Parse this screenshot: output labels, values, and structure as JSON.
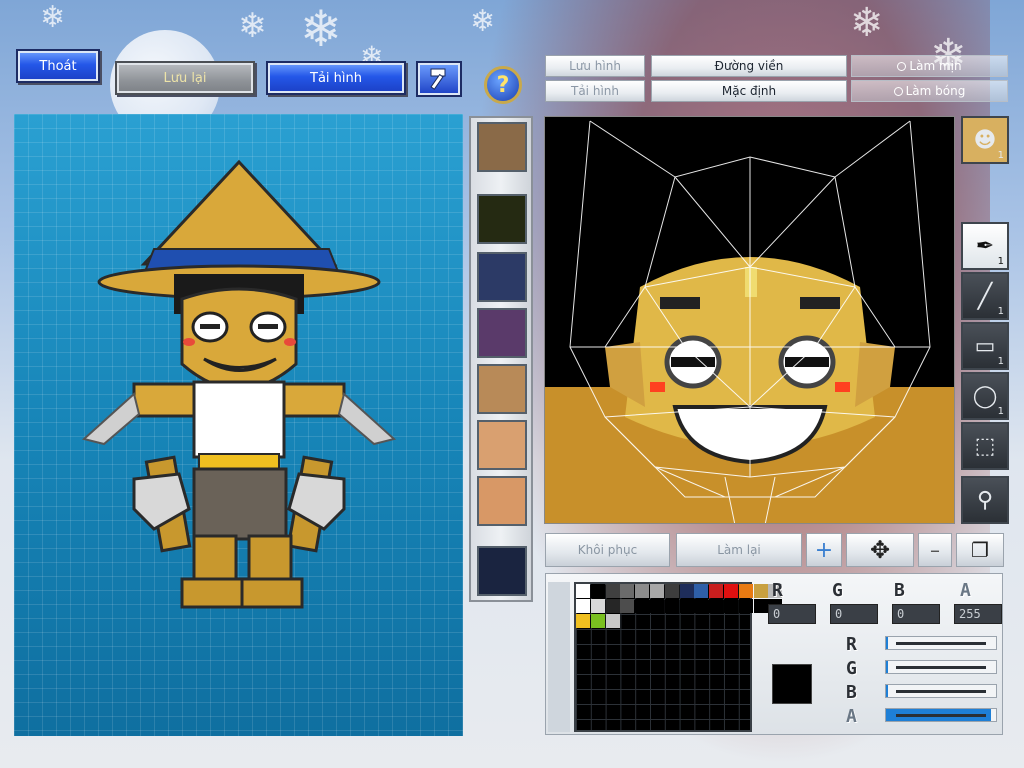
{
  "top_buttons": {
    "exit": "Thoát",
    "save": "Lưu lại",
    "reload": "Tải hình"
  },
  "help_glyph": "?",
  "toolbar": {
    "save_image": "Lưu hình",
    "load_image": "Tải hình",
    "outline": "Đường viền",
    "default": "Mặc định",
    "smooth": "Làm mịn",
    "shade": "Làm bóng"
  },
  "editor_controls": {
    "restore": "Khôi phục",
    "redo": "Làm lại"
  },
  "channels": {
    "r_label": "R",
    "g_label": "G",
    "b_label": "B",
    "a_label": "A",
    "r_value": "0",
    "g_value": "0",
    "b_value": "0",
    "a_value": "255"
  },
  "sliders": [
    {
      "name": "R",
      "level": 0.02
    },
    {
      "name": "G",
      "level": 0.02
    },
    {
      "name": "B",
      "level": 0.02
    },
    {
      "name": "A",
      "level": 0.95
    }
  ],
  "tool_counts": {
    "face_preview": "1",
    "pen": "1",
    "line": "1",
    "rect": "1",
    "ellipse": "1"
  },
  "palette": {
    "row1": [
      "#ffffff",
      "#000000",
      "#404040",
      "#6b6b6b",
      "#8c8c8c",
      "#a8a8a8",
      "#3d3d3d",
      "#1e2d5a",
      "#2e5fa8",
      "#c81e1e",
      "#e01010",
      "#e87a12",
      "#c8a040",
      "#b8b8b8"
    ],
    "row2": [
      "#ffffff",
      "#d8d8d8",
      "#262626",
      "#4d4d4d",
      "#000000",
      "#000000",
      "#000000",
      "#000000",
      "#000000",
      "#000000",
      "#000000",
      "#000000",
      "#000000",
      "#000000"
    ],
    "row3": [
      "#f0c020",
      "#7ac020",
      "#c8c8c8"
    ]
  },
  "current_color": "#000000",
  "icons": {
    "hammer": "hammer-icon",
    "help": "help-icon",
    "add": "plus-icon",
    "move": "move-arrows-icon",
    "minus": "minus-icon",
    "layers": "layers-icon"
  }
}
